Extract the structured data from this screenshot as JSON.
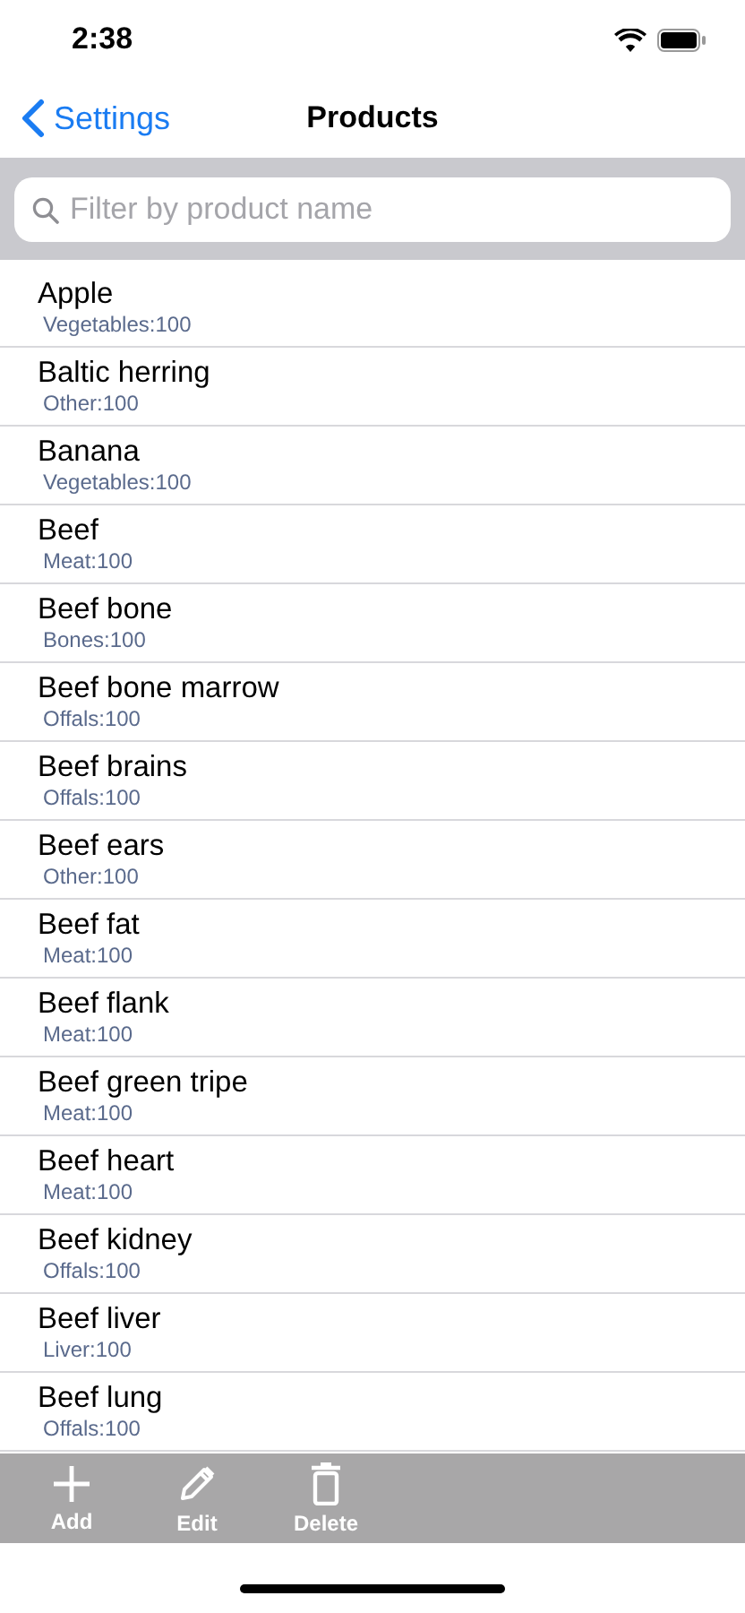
{
  "status_bar": {
    "time": "2:38"
  },
  "nav": {
    "back": "Settings",
    "title": "Products"
  },
  "search": {
    "placeholder": "Filter by product name"
  },
  "products": [
    {
      "name": "Apple",
      "detail": "Vegetables:100"
    },
    {
      "name": "Baltic herring",
      "detail": "Other:100"
    },
    {
      "name": "Banana",
      "detail": "Vegetables:100"
    },
    {
      "name": "Beef",
      "detail": "Meat:100"
    },
    {
      "name": "Beef bone",
      "detail": "Bones:100"
    },
    {
      "name": "Beef bone marrow",
      "detail": "Offals:100"
    },
    {
      "name": "Beef brains",
      "detail": "Offals:100"
    },
    {
      "name": "Beef ears",
      "detail": "Other:100"
    },
    {
      "name": "Beef fat",
      "detail": "Meat:100"
    },
    {
      "name": "Beef flank",
      "detail": "Meat:100"
    },
    {
      "name": "Beef green tripe",
      "detail": "Meat:100"
    },
    {
      "name": "Beef heart",
      "detail": "Meat:100"
    },
    {
      "name": "Beef kidney",
      "detail": "Offals:100"
    },
    {
      "name": "Beef liver",
      "detail": "Liver:100"
    },
    {
      "name": "Beef lung",
      "detail": "Offals:100"
    }
  ],
  "toolbar": [
    {
      "kind": "add",
      "label": "Add"
    },
    {
      "kind": "edit",
      "label": "Edit"
    },
    {
      "kind": "delete",
      "label": "Delete"
    }
  ]
}
